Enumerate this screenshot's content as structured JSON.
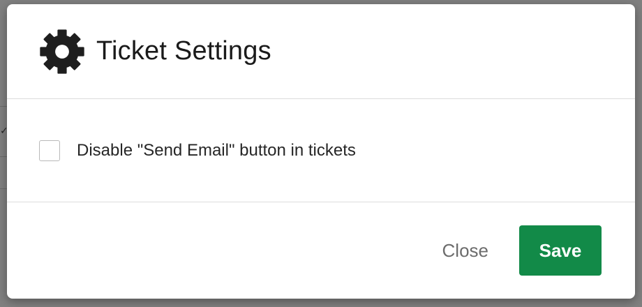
{
  "dialog": {
    "title": "Ticket Settings",
    "icon": "gear-icon",
    "options": [
      {
        "label": "Disable \"Send Email\" button in tickets",
        "checked": false
      }
    ],
    "buttons": {
      "close_label": "Close",
      "save_label": "Save"
    }
  },
  "colors": {
    "save_button": "#128a48",
    "overlay": "#7d7d7d"
  },
  "backdrop": {
    "check_glyph": "✓"
  }
}
